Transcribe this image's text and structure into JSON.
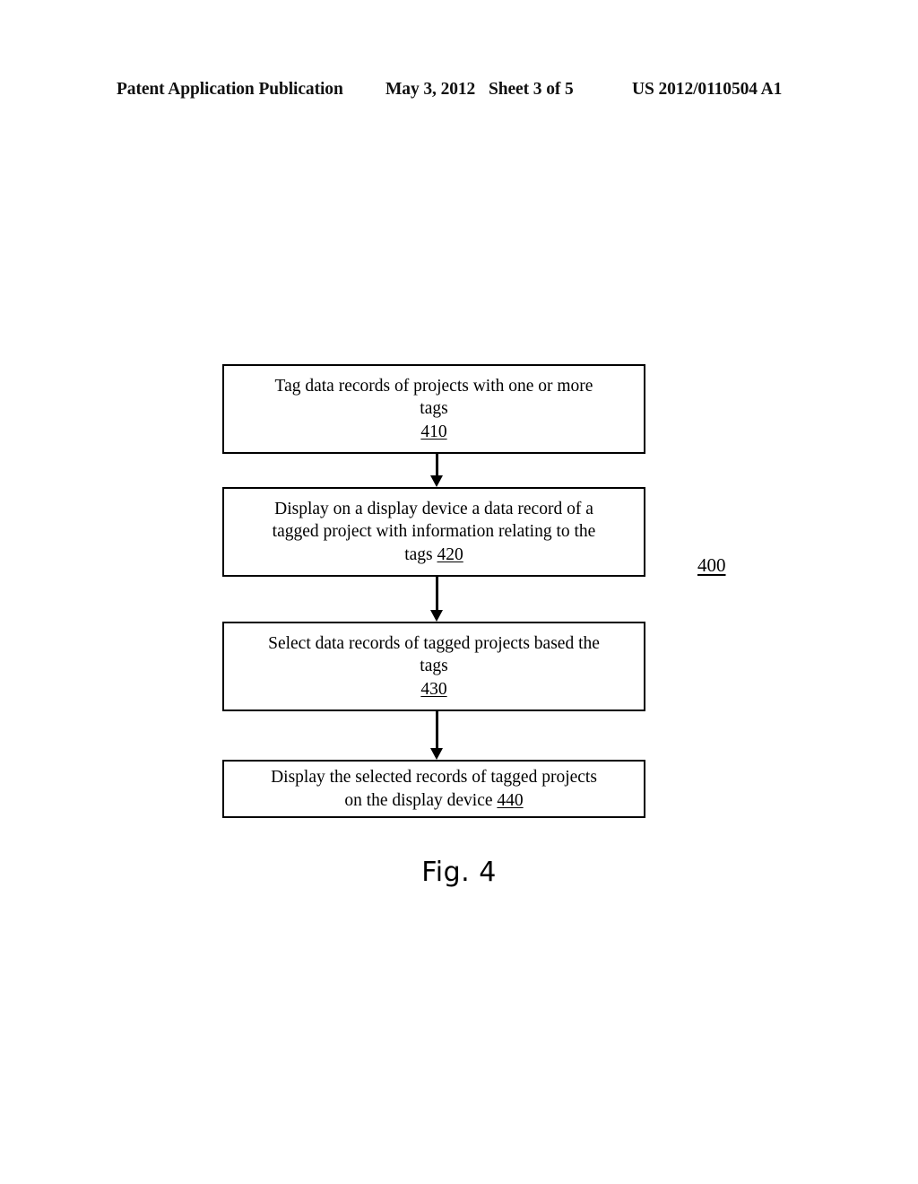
{
  "header": {
    "publication": "Patent Application Publication",
    "date": "May 3, 2012",
    "sheet": "Sheet 3 of 5",
    "publication_number": "US 2012/0110504 A1"
  },
  "figure": {
    "caption": "Fig. 4",
    "reference_numeral": "400",
    "steps": [
      {
        "id": "410",
        "text": "Tag data records of projects with one or more\ntags\n",
        "number": "410",
        "number_inline": false
      },
      {
        "id": "420",
        "text": "Display on a display device a data record of a\ntagged project with information relating to the\ntags  ",
        "number": "420",
        "number_inline": true
      },
      {
        "id": "430",
        "text": "Select data records of tagged projects based the\ntags\n",
        "number": "430",
        "number_inline": false
      },
      {
        "id": "440",
        "text": "Display the selected records of tagged projects\non the display device  ",
        "number": "440",
        "number_inline": true
      }
    ],
    "connectors": [
      {
        "from": "410",
        "to": "420",
        "type": "down-arrow"
      },
      {
        "from": "420",
        "to": "430",
        "type": "down-arrow"
      },
      {
        "from": "430",
        "to": "440",
        "type": "down-arrow"
      }
    ]
  },
  "colors": {
    "background": "#ffffff",
    "ink": "#000000"
  }
}
